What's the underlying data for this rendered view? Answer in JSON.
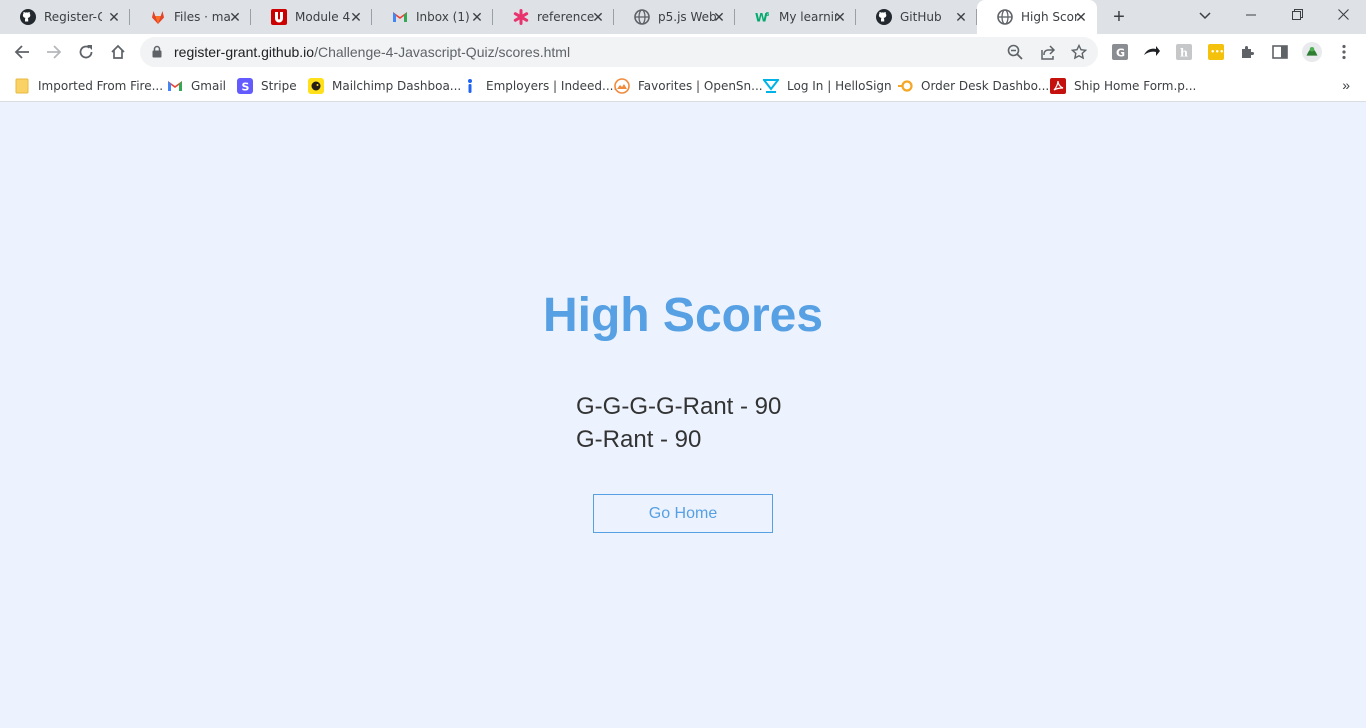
{
  "browser": {
    "tabs": [
      {
        "title": "Register-G",
        "icon": "github-icon"
      },
      {
        "title": "Files · main",
        "icon": "gitlab-icon"
      },
      {
        "title": "Module 4 (",
        "icon": "utah-u-icon"
      },
      {
        "title": "Inbox (1) -",
        "icon": "gmail-icon"
      },
      {
        "title": "reference |",
        "icon": "asterisk-icon"
      },
      {
        "title": "p5.js Web",
        "icon": "globe-icon"
      },
      {
        "title": "My learnin",
        "icon": "w3-icon"
      },
      {
        "title": "GitHub",
        "icon": "github-icon"
      },
      {
        "title": "High Scores",
        "icon": "globe-icon",
        "active": true
      }
    ],
    "new_tab_label": "+",
    "address": {
      "host": "register-grant.github.io",
      "path": "/Challenge-4-Javascript-Quiz/scores.html"
    },
    "bookmarks": [
      {
        "label": "Imported From Fire...",
        "icon": "folder-icon"
      },
      {
        "label": "Gmail",
        "icon": "gmail-icon"
      },
      {
        "label": "Stripe",
        "icon": "stripe-icon"
      },
      {
        "label": "Mailchimp Dashboa...",
        "icon": "mailchimp-icon"
      },
      {
        "label": "Employers | Indeed....",
        "icon": "indeed-icon"
      },
      {
        "label": "Favorites | OpenSn...",
        "icon": "opensnow-icon"
      },
      {
        "label": "Log In | HelloSign",
        "icon": "hellosign-icon"
      },
      {
        "label": "Order Desk Dashbo...",
        "icon": "orderdesk-icon"
      },
      {
        "label": "Ship Home Form.p...",
        "icon": "pdf-icon"
      }
    ]
  },
  "page": {
    "heading": "High Scores",
    "scores": [
      "G-G-G-G-Rant - 90",
      "G-Rant - 90"
    ],
    "go_home_label": "Go Home"
  },
  "colors": {
    "page_background": "#ecf3fe",
    "accent": "#56a0e3",
    "score_text": "#333333"
  }
}
